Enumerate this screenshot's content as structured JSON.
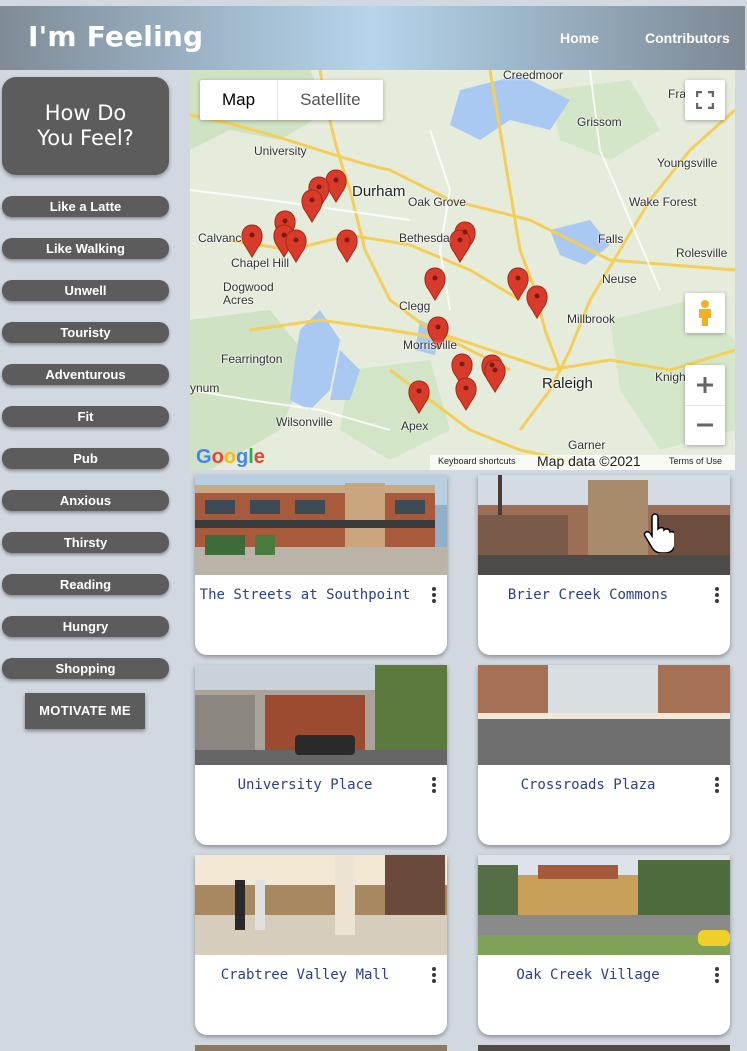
{
  "header": {
    "title": "I'm Feeling",
    "nav": [
      "Home",
      "Contributors"
    ]
  },
  "sidebar": {
    "prompt_line1": "How Do",
    "prompt_line2": "You Feel?",
    "moods": [
      "Like a Latte",
      "Like Walking",
      "Unwell",
      "Touristy",
      "Adventurous",
      "Fit",
      "Pub",
      "Anxious",
      "Thirsty",
      "Reading",
      "Hungry",
      "Shopping"
    ],
    "motivate_label": "MOTIVATE ME"
  },
  "map": {
    "map_label": "Map",
    "satellite_label": "Satellite",
    "places": {
      "creedmoor": "Creedmoor",
      "franklinton": "Fra",
      "grissom": "Grissom",
      "youngsville": "Youngsville",
      "university": "University",
      "durham": "Durham",
      "oak_grove": "Oak Grove",
      "wake_forest": "Wake Forest",
      "calvander": "Calvanc",
      "bethesda": "Bethesda",
      "falls": "Falls",
      "rolesville": "Rolesville",
      "chapel_hill": "Chapel Hill",
      "dogwood_acres": "Dogwood\nAcres",
      "clegg": "Clegg",
      "neuse": "Neuse",
      "millbrook": "Millbrook",
      "fearrington": "Fearrington",
      "morrisville": "Morrisville",
      "raleigh": "Raleigh",
      "knightdale": "Knigh",
      "lynum": "ynum",
      "wilsonville": "Wilsonville",
      "apex": "Apex",
      "garner": "Garner"
    },
    "logo": "Google",
    "keyboard_shortcuts": "Keyboard shortcuts",
    "map_data": "Map data ©2021",
    "terms": "Terms of Use"
  },
  "places": [
    {
      "name": "The Streets at Southpoint"
    },
    {
      "name": "Brier Creek Commons"
    },
    {
      "name": "University Place"
    },
    {
      "name": "Crossroads Plaza"
    },
    {
      "name": "Crabtree Valley Mall"
    },
    {
      "name": "Oak Creek Village"
    }
  ],
  "colors": {
    "sidebar_button": "#5c5c5c",
    "card_title": "#2a3f8f",
    "pin": "#d93b2b",
    "page_background": "#d1d8e0"
  }
}
